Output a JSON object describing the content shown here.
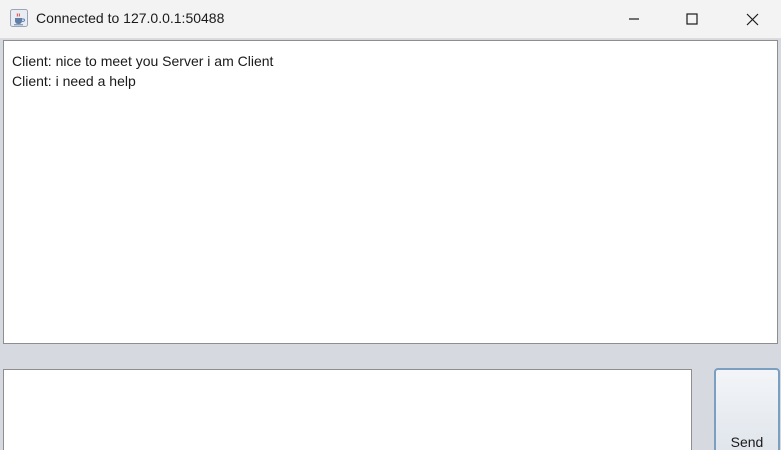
{
  "window": {
    "title": "Connected to 127.0.0.1:50488",
    "icon": "java-cup-icon",
    "controls": {
      "minimize": "minimize-icon",
      "maximize": "maximize-icon",
      "close": "close-icon"
    }
  },
  "chat": {
    "messages": [
      "Client: nice to meet you Server i am Client",
      "Client: i need a help"
    ]
  },
  "composer": {
    "value": "",
    "send_label": "Send"
  },
  "colors": {
    "panel_background": "#d6d9df",
    "titlebar_background": "#f3f3f3",
    "send_border": "#7a9fc0"
  }
}
